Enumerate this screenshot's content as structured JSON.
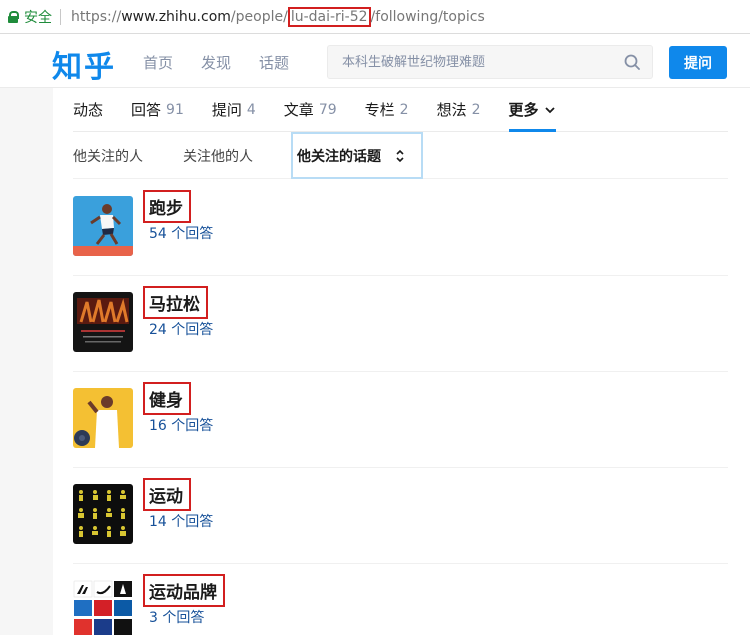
{
  "addressbar": {
    "secure_label": "安全",
    "url_scheme": "https://",
    "url_host": "www.zhihu.com",
    "url_path_before": "/people/",
    "url_highlight": "lu-dai-ri-52",
    "url_path_after": "/following/topics"
  },
  "header": {
    "logo": "知乎",
    "nav": [
      "首页",
      "发现",
      "话题"
    ],
    "search_placeholder": "本科生破解世纪物理难题",
    "ask_button": "提问"
  },
  "tabs": [
    {
      "label": "动态",
      "count": ""
    },
    {
      "label": "回答",
      "count": "91"
    },
    {
      "label": "提问",
      "count": "4"
    },
    {
      "label": "文章",
      "count": "79"
    },
    {
      "label": "专栏",
      "count": "2"
    },
    {
      "label": "想法",
      "count": "2"
    },
    {
      "label": "更多",
      "count": ""
    }
  ],
  "subtabs": [
    "他关注的人",
    "关注他的人",
    "他关注的话题"
  ],
  "topics": [
    {
      "name": "跑步",
      "count": "54 个回答",
      "icon": "runner-image"
    },
    {
      "name": "马拉松",
      "count": "24 个回答",
      "icon": "marathon-poster-image"
    },
    {
      "name": "健身",
      "count": "16 个回答",
      "icon": "fitness-image"
    },
    {
      "name": "运动",
      "count": "14 个回答",
      "icon": "sports-pictograms-image"
    },
    {
      "name": "运动品牌",
      "count": "3 个回答",
      "icon": "brand-logos-image"
    }
  ],
  "colors": {
    "accent": "#0f88eb",
    "highlight_box": "#d21f1f",
    "count_link": "#175199"
  }
}
